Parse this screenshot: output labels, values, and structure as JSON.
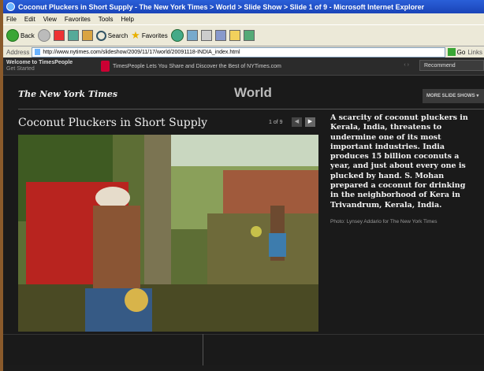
{
  "window": {
    "title": "Coconut Pluckers in Short Supply - The New York Times > World > Slide Show > Slide 1 of 9 - Microsoft Internet Explorer"
  },
  "menu": [
    "File",
    "Edit",
    "View",
    "Favorites",
    "Tools",
    "Help"
  ],
  "toolbar": {
    "back_label": "Back",
    "search_label": "Search",
    "favorites_label": "Favorites"
  },
  "address": {
    "label": "Address",
    "url": "http://www.nytimes.com/slideshow/2009/11/17/world/20091118-INDIA_index.html",
    "go_label": "Go",
    "links_label": "Links"
  },
  "timespeople": {
    "welcome": "Welcome to TimesPeople",
    "get_started": "Get Started",
    "tagline": "TimesPeople Lets You Share and Discover the Best of NYTimes.com",
    "arrows": "‹ ›",
    "recommend": "Recommend"
  },
  "page": {
    "logo": "The New York Times",
    "section": "World",
    "more_slide_shows": "MORE SLIDE SHOWS ▾",
    "slide_title": "Coconut Pluckers in Short Supply",
    "counter": "1 of 9",
    "prev": "◀",
    "next": "▶",
    "caption": "A scarcity of coconut pluckers in Kerala, India, threatens to undermine one of its most important industries. India produces 15 billion coconuts a year, and just about every one is plucked by hand. S. Mohan prepared a coconut for drinking in the neighborhood of Kera in Trivandrum, Kerala, India.",
    "credit": "Photo: Lynsey Addario for The New York Times"
  },
  "colors": {
    "titlebar": "#1a44b8",
    "chrome": "#ece9d8",
    "page_bg": "#1a1a1a",
    "desktop": "#8a5a2b"
  }
}
